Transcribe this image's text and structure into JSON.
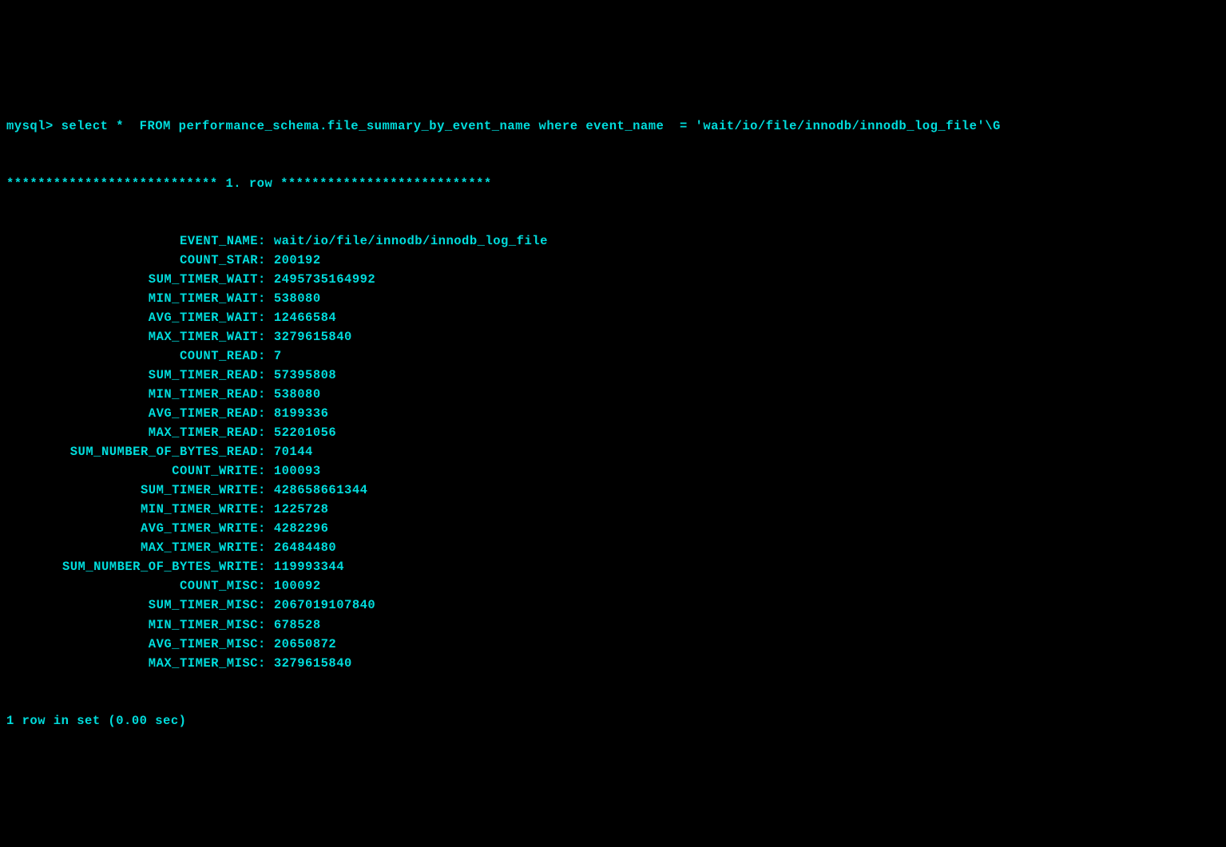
{
  "prompt": "mysql>",
  "query": "select *  FROM performance_schema.file_summary_by_event_name where event_name  = 'wait/io/file/innodb/innodb_log_file'\\G",
  "row_header_stars_left": "***************************",
  "row_header_text": " 1. row ",
  "row_header_stars_right": "***************************",
  "fields": [
    {
      "label": "EVENT_NAME",
      "value": "wait/io/file/innodb/innodb_log_file"
    },
    {
      "label": "COUNT_STAR",
      "value": "200192"
    },
    {
      "label": "SUM_TIMER_WAIT",
      "value": "2495735164992"
    },
    {
      "label": "MIN_TIMER_WAIT",
      "value": "538080"
    },
    {
      "label": "AVG_TIMER_WAIT",
      "value": "12466584"
    },
    {
      "label": "MAX_TIMER_WAIT",
      "value": "3279615840"
    },
    {
      "label": "COUNT_READ",
      "value": "7"
    },
    {
      "label": "SUM_TIMER_READ",
      "value": "57395808"
    },
    {
      "label": "MIN_TIMER_READ",
      "value": "538080"
    },
    {
      "label": "AVG_TIMER_READ",
      "value": "8199336"
    },
    {
      "label": "MAX_TIMER_READ",
      "value": "52201056"
    },
    {
      "label": "SUM_NUMBER_OF_BYTES_READ",
      "value": "70144"
    },
    {
      "label": "COUNT_WRITE",
      "value": "100093"
    },
    {
      "label": "SUM_TIMER_WRITE",
      "value": "428658661344"
    },
    {
      "label": "MIN_TIMER_WRITE",
      "value": "1225728"
    },
    {
      "label": "AVG_TIMER_WRITE",
      "value": "4282296"
    },
    {
      "label": "MAX_TIMER_WRITE",
      "value": "26484480"
    },
    {
      "label": "SUM_NUMBER_OF_BYTES_WRITE",
      "value": "119993344"
    },
    {
      "label": "COUNT_MISC",
      "value": "100092"
    },
    {
      "label": "SUM_TIMER_MISC",
      "value": "2067019107840"
    },
    {
      "label": "MIN_TIMER_MISC",
      "value": "678528"
    },
    {
      "label": "AVG_TIMER_MISC",
      "value": "20650872"
    },
    {
      "label": "MAX_TIMER_MISC",
      "value": "3279615840"
    }
  ],
  "footer": "1 row in set (0.00 sec)"
}
